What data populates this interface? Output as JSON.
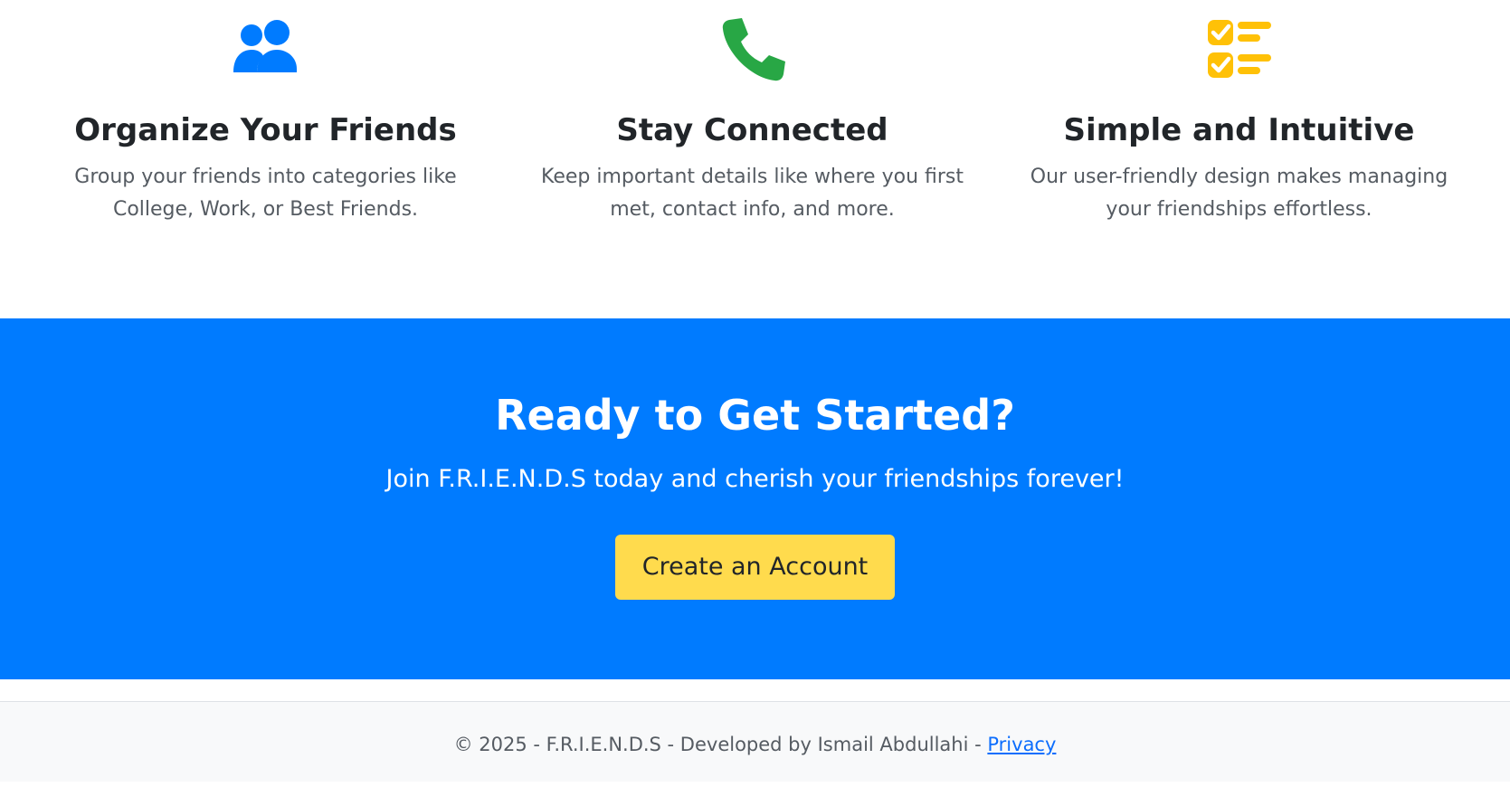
{
  "features": [
    {
      "icon": "users-icon",
      "icon_color": "#007bff",
      "title": "Organize Your Friends",
      "description": "Group your friends into categories like College, Work, or Best Friends."
    },
    {
      "icon": "phone-icon",
      "icon_color": "#28a745",
      "title": "Stay Connected",
      "description": "Keep important details like where you first met, contact info, and more."
    },
    {
      "icon": "checklist-icon",
      "icon_color": "#ffc107",
      "title": "Simple and Intuitive",
      "description": "Our user-friendly design makes managing your friendships effortless."
    }
  ],
  "cta": {
    "heading": "Ready to Get Started?",
    "subtext": "Join F.R.I.E.N.D.S today and cherish your friendships forever!",
    "button_label": "Create an Account",
    "background_color": "#007bff",
    "button_color": "#ffdb4d"
  },
  "footer": {
    "copyright": "© 2025 - F.R.I.E.N.D.S - Developed by Ismail Abdullahi - ",
    "privacy_link": "Privacy"
  }
}
